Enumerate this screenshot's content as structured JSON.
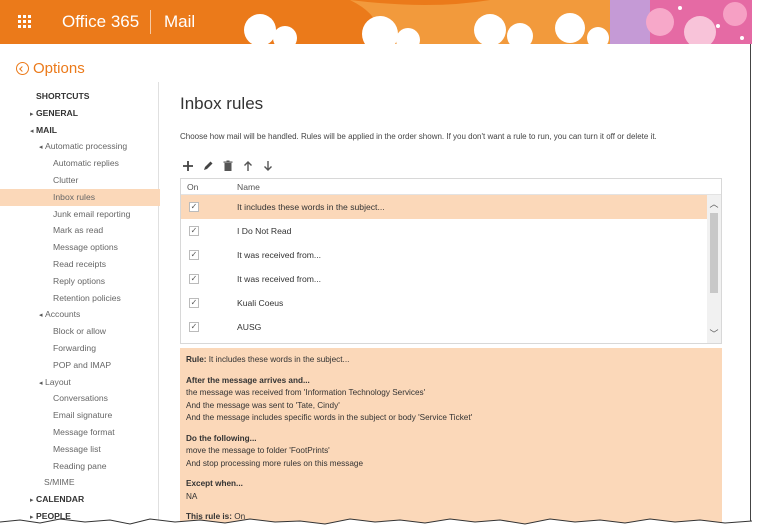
{
  "header": {
    "brand": "Office 365",
    "app": "Mail",
    "colors": {
      "bar": "#eb7a1a",
      "selection": "#fbd8b9"
    }
  },
  "options_label": "Options",
  "nav": [
    {
      "label": "SHORTCUTS",
      "level": 0,
      "arrow": ""
    },
    {
      "label": "GENERAL",
      "level": 0,
      "arrow": "▸"
    },
    {
      "label": "MAIL",
      "level": 0,
      "arrow": "◂"
    },
    {
      "label": "Automatic processing",
      "level": 1,
      "arrow": "◂"
    },
    {
      "label": "Automatic replies",
      "level": 2
    },
    {
      "label": "Clutter",
      "level": 2
    },
    {
      "label": "Inbox rules",
      "level": 2,
      "selected": true
    },
    {
      "label": "Junk email reporting",
      "level": 2
    },
    {
      "label": "Mark as read",
      "level": 2
    },
    {
      "label": "Message options",
      "level": 2
    },
    {
      "label": "Read receipts",
      "level": 2
    },
    {
      "label": "Reply options",
      "level": 2
    },
    {
      "label": "Retention policies",
      "level": 2
    },
    {
      "label": "Accounts",
      "level": 1,
      "arrow": "◂"
    },
    {
      "label": "Block or allow",
      "level": 2
    },
    {
      "label": "Forwarding",
      "level": 2
    },
    {
      "label": "POP and IMAP",
      "level": 2
    },
    {
      "label": "Layout",
      "level": 1,
      "arrow": "◂"
    },
    {
      "label": "Conversations",
      "level": 2
    },
    {
      "label": "Email signature",
      "level": 2
    },
    {
      "label": "Message format",
      "level": 2
    },
    {
      "label": "Message list",
      "level": 2
    },
    {
      "label": "Reading pane",
      "level": 2
    },
    {
      "label": "S/MIME",
      "level": 1
    },
    {
      "label": "CALENDAR",
      "level": 0,
      "arrow": "▸"
    },
    {
      "label": "PEOPLE",
      "level": 0,
      "arrow": "▸"
    }
  ],
  "main": {
    "title": "Inbox rules",
    "description": "Choose how mail will be handled. Rules will be applied in the order shown. If you don't want a rule to run, you can turn it off or delete it.",
    "toolbar": {
      "add_icon": "plus-icon",
      "edit_icon": "pencil-icon",
      "delete_icon": "trash-icon",
      "move_up_icon": "arrow-up-icon",
      "move_down_icon": "arrow-down-icon"
    },
    "columns": {
      "on": "On",
      "name": "Name"
    },
    "rules": [
      {
        "on": true,
        "name": "It includes these words in the subject...",
        "selected": true
      },
      {
        "on": true,
        "name": "I Do Not Read"
      },
      {
        "on": true,
        "name": "It was received from..."
      },
      {
        "on": true,
        "name": "It was received from..."
      },
      {
        "on": true,
        "name": "Kuali Coeus"
      },
      {
        "on": true,
        "name": "AUSG"
      }
    ],
    "details": {
      "rule_label": "Rule:",
      "rule_value": "It includes these words in the subject...",
      "after_heading": "After the message arrives and...",
      "after_lines": [
        "the message was received from 'Information Technology Services'",
        "And the message was sent to 'Tate, Cindy'",
        "And the message includes specific words in the subject or body 'Service Ticket'"
      ],
      "do_heading": "Do the following...",
      "do_lines": [
        "move the message to folder 'FootPrints'",
        "And stop processing more rules on this message"
      ],
      "except_heading": "Except when...",
      "except_value": "NA",
      "status_label": "This rule is:",
      "status_value": "On"
    }
  }
}
